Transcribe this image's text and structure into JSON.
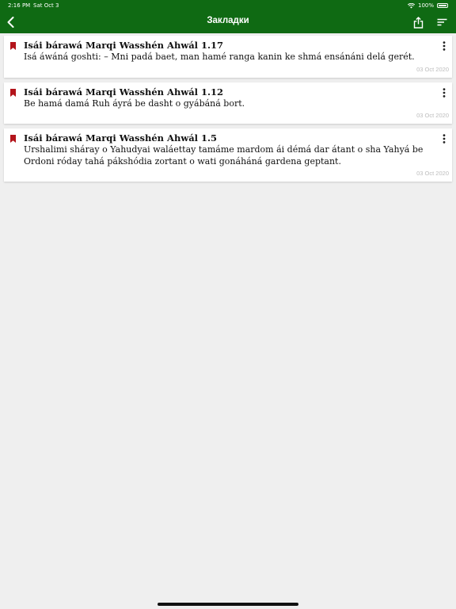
{
  "status_bar": {
    "time": "2:16 PM",
    "date": "Sat Oct 3",
    "battery": "100%",
    "battery_level": 1.0
  },
  "nav": {
    "title": "Закладки",
    "back_icon": "chevron-left-icon",
    "share_icon": "share-icon",
    "sort_icon": "sort-icon"
  },
  "colors": {
    "header_bg": "#0f6a13",
    "bookmark_red": "#b3141b",
    "background": "#efefef"
  },
  "bookmarks": [
    {
      "ref": "Isái bárawá Marqi Wasshén Ahwál 1.17",
      "text": "Isá áwáná goshti: – Mni padá baet, man hamé ranga kanin ke shmá ensánáni delá gerét.",
      "date": "03 Oct 2020"
    },
    {
      "ref": "Isái bárawá Marqi Wasshén Ahwál 1.12",
      "text": "Be hamá damá Ruh áyrá be dasht o gyábáná bort.",
      "date": "03 Oct 2020"
    },
    {
      "ref": "Isái bárawá Marqi Wasshén Ahwál 1.5",
      "text": "Urshalimi sháray o Yahudyai waláettay tamáme mardom ái démá dar átant o sha Yahyá be Ordoni róday tahá pákshódia zortant o wati gonáháná gardena geptant.",
      "date": "03 Oct 2020"
    }
  ]
}
